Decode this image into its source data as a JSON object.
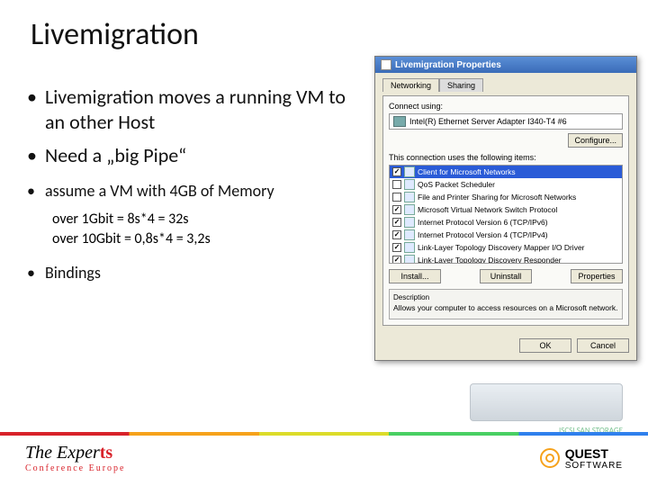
{
  "slide": {
    "title": "Livemigration",
    "bullets": [
      "Livemigration moves a running VM to an other Host",
      "Need a „big Pipe“"
    ],
    "assume": "assume a VM with 4GB of Memory",
    "calc1": "over 1Gbit = 8s*4 = 32s",
    "calc2": "over 10Gbit = 0,8s*4 = 3,2s",
    "bindings": "Bindings"
  },
  "dialog": {
    "title": "Livemigration Properties",
    "tabs": {
      "networking": "Networking",
      "sharing": "Sharing"
    },
    "connect_using": "Connect using:",
    "adapter": "Intel(R) Ethernet Server Adapter I340-T4 #6",
    "configure": "Configure...",
    "items_label": "This connection uses the following items:",
    "items": [
      {
        "checked": true,
        "label": "Client for Microsoft Networks",
        "selected": true
      },
      {
        "checked": false,
        "label": "QoS Packet Scheduler"
      },
      {
        "checked": false,
        "label": "File and Printer Sharing for Microsoft Networks"
      },
      {
        "checked": true,
        "label": "Microsoft Virtual Network Switch Protocol"
      },
      {
        "checked": true,
        "label": "Internet Protocol Version 6 (TCP/IPv6)"
      },
      {
        "checked": true,
        "label": "Internet Protocol Version 4 (TCP/IPv4)"
      },
      {
        "checked": true,
        "label": "Link-Layer Topology Discovery Mapper I/O Driver"
      },
      {
        "checked": true,
        "label": "Link-Layer Topology Discovery Responder"
      }
    ],
    "install": "Install...",
    "uninstall": "Uninstall",
    "properties": "Properties",
    "desc_h": "Description",
    "desc": "Allows your computer to access resources on a Microsoft network.",
    "ok": "OK",
    "cancel": "Cancel"
  },
  "footer": {
    "left1a": "The Exper",
    "left1b": "ts",
    "left2": "Conference Europe",
    "right_brand": "QUEST",
    "right_soft": "SOFTWARE"
  },
  "server_label": "ISCSI SAN STORAGE"
}
